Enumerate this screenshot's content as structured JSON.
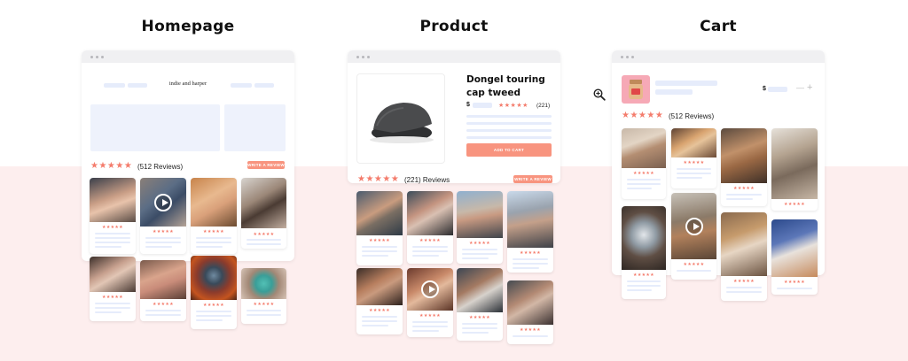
{
  "titles": {
    "homepage": "Homepage",
    "product": "Product",
    "cart": "Cart"
  },
  "homepage": {
    "store_name": "indie and harper",
    "reviews_text": "(512 Reviews)",
    "stars": "★★★★★",
    "write_button": "WRITE A REVIEW"
  },
  "product": {
    "name": "Dongel touring cap tweed",
    "currency": "$",
    "rating_count": "(221)",
    "add_to_cart": "ADD TO CART",
    "reviews_text": "(221) Reviews",
    "stars": "★★★★★",
    "write_button": "WRITE A REVIEW"
  },
  "cart": {
    "currency": "$",
    "minus": "—",
    "plus": "+",
    "reviews_text": "(512 Reviews)",
    "stars": "★★★★★"
  },
  "card_stars": "★★★★★",
  "colors": {
    "accent": "#f8947f",
    "star": "#f47c6c",
    "placeholder": "#e6ecfb",
    "bg_pink": "#fdeeee"
  },
  "icons": {
    "zoom": "zoom-in-icon",
    "play": "play-icon"
  }
}
